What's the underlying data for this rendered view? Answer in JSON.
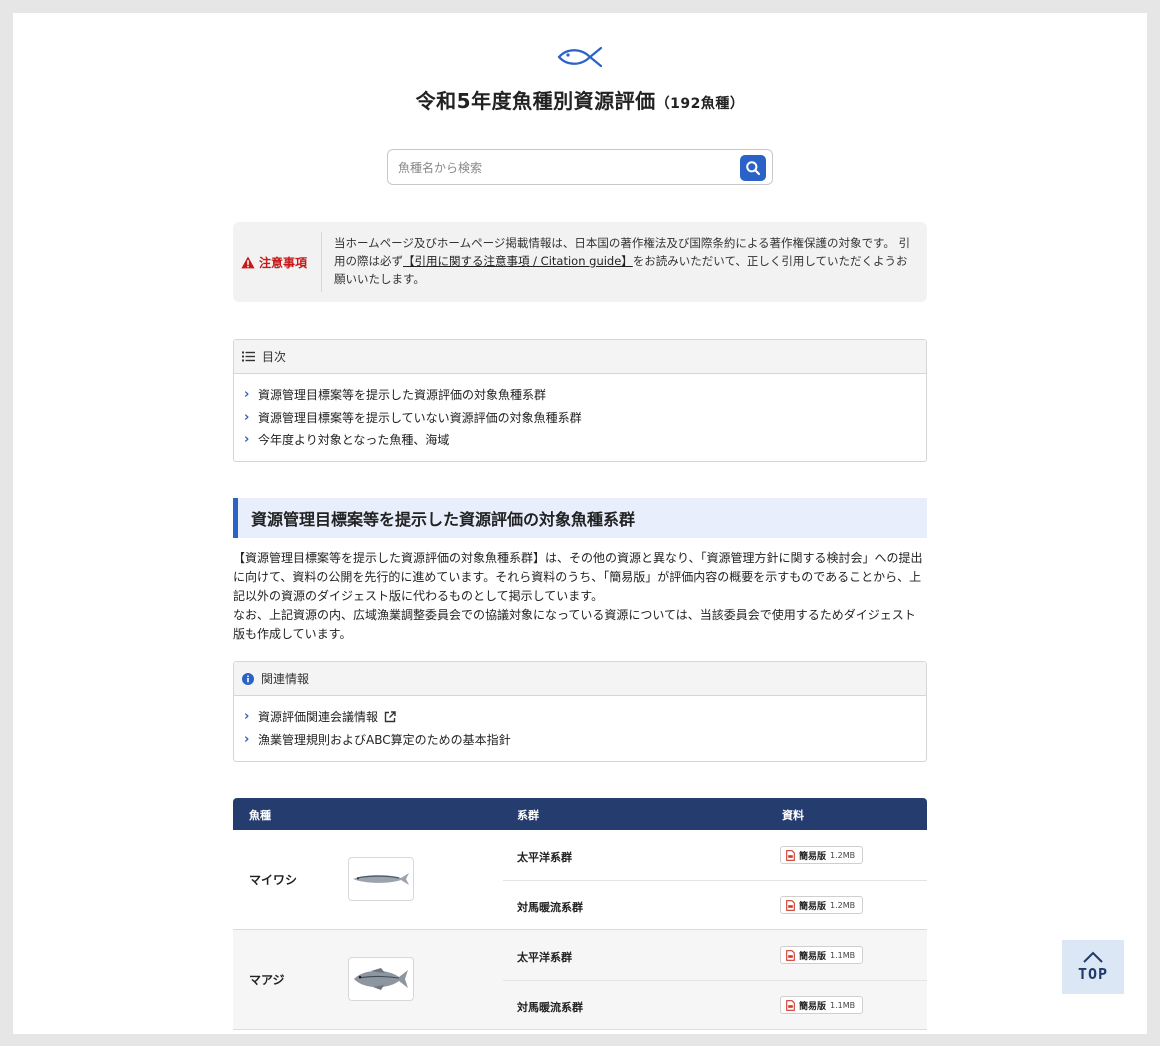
{
  "header": {
    "title": "令和5年度魚種別資源評価",
    "count": "（192魚種）"
  },
  "search": {
    "placeholder": "魚種名から検索"
  },
  "notice": {
    "label": "注意事項",
    "text_before": "当ホームページ及びホームページ掲載情報は、日本国の著作権法及び国際条約による著作権保護の対象です。 引用の際は必ず",
    "link": "【引用に関する注意事項 / Citation guide】",
    "text_after": "をお読みいただいて、正しく引用していただくようお願いいたします。"
  },
  "toc": {
    "title": "目次",
    "items": [
      "資源管理目標案等を提示した資源評価の対象魚種系群",
      "資源管理目標案等を提示していない資源評価の対象魚種系群",
      "今年度より対象となった魚種、海域"
    ]
  },
  "section": {
    "heading": "資源管理目標案等を提示した資源評価の対象魚種系群",
    "paragraph1": "【資源管理目標案等を提示した資源評価の対象魚種系群】は、その他の資源と異なり、「資源管理方針に関する検討会」への提出に向けて、資料の公開を先行的に進めています。それら資料のうち、「簡易版」が評価内容の概要を示すものであることから、上記以外の資源のダイジェスト版に代わるものとして掲示しています。",
    "paragraph2": "なお、上記資源の内、広域漁業調整委員会での協議対象になっている資源については、当該委員会で使用するためダイジェスト版も作成しています。"
  },
  "related": {
    "title": "関連情報",
    "items": [
      "資源評価関連会議情報",
      "漁業管理規則およびABC算定のための基本指針"
    ]
  },
  "table": {
    "headers": [
      "魚種",
      "系群",
      "資料"
    ],
    "groups": [
      {
        "name": "マイワシ",
        "rows": [
          {
            "stock": "太平洋系群",
            "doc": "簡易版",
            "size": "1.2MB"
          },
          {
            "stock": "対馬暖流系群",
            "doc": "簡易版",
            "size": "1.2MB"
          }
        ]
      },
      {
        "name": "マアジ",
        "rows": [
          {
            "stock": "太平洋系群",
            "doc": "簡易版",
            "size": "1.1MB"
          },
          {
            "stock": "対馬暖流系群",
            "doc": "簡易版",
            "size": "1.1MB"
          }
        ]
      }
    ]
  },
  "top_button": {
    "label": "TOP"
  },
  "colors": {
    "accent": "#2a62c8",
    "table_header": "#253d6e",
    "warning": "#c81818",
    "top_bg": "#dce7f6"
  }
}
